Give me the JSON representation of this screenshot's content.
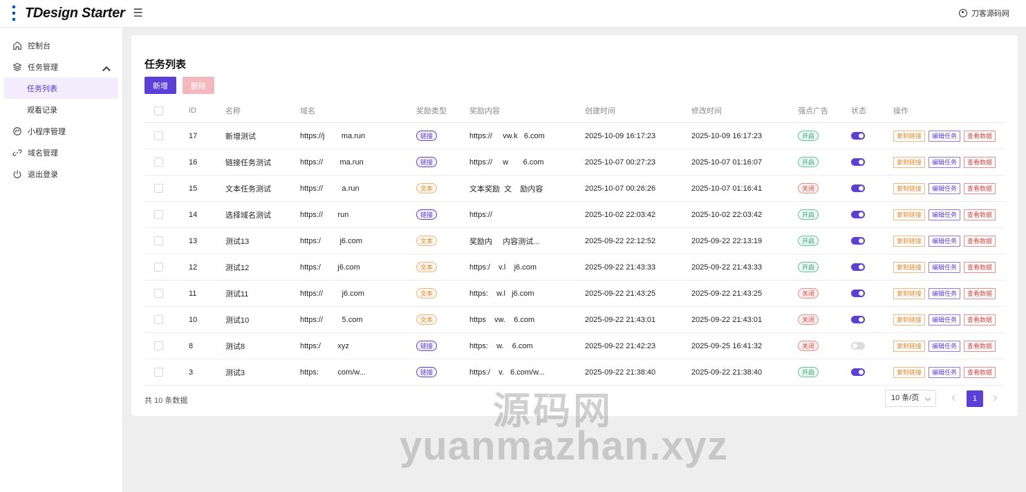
{
  "header": {
    "logo_text": "TDesign Starter",
    "menu_icon": "menu-icon",
    "user_name": "刀客源码网",
    "user_icon": "user-circle-icon"
  },
  "sidebar": {
    "items": [
      {
        "label": "控制台",
        "icon": "home-icon"
      },
      {
        "label": "任务管理",
        "icon": "layers-icon",
        "expanded": true
      },
      {
        "label": "任务列表",
        "sub": true,
        "active": true
      },
      {
        "label": "观看记录",
        "sub": true
      },
      {
        "label": "小程序管理",
        "icon": "miniapp-icon"
      },
      {
        "label": "域名管理",
        "icon": "link-icon"
      },
      {
        "label": "退出登录",
        "icon": "power-icon"
      }
    ]
  },
  "page": {
    "title": "任务列表",
    "add_label": "新增",
    "delete_label": "删除"
  },
  "table": {
    "columns": [
      "ID",
      "名称",
      "域名",
      "奖励类型",
      "奖励内容",
      "创建时间",
      "修改时间",
      "强点广告",
      "状态",
      "操作"
    ],
    "action_labels": {
      "copy": "复制链接",
      "edit": "编辑任务",
      "view": "查看数据"
    },
    "rows": [
      {
        "id": "17",
        "name": "新增测试",
        "domain": "https://j        ma.run",
        "type": "链接",
        "reward": "https://     vw.k   6.com",
        "created": "2025-10-09 16:17:23",
        "updated": "2025-10-09 16:17:23",
        "ad": "开启",
        "enabled": true
      },
      {
        "id": "16",
        "name": "链接任务测试",
        "domain": "https://        ma.run",
        "type": "链接",
        "reward": "https://     w       6.com",
        "created": "2025-10-07 00:27:23",
        "updated": "2025-10-07 01:16:07",
        "ad": "开启",
        "enabled": true
      },
      {
        "id": "15",
        "name": "文本任务测试",
        "domain": "https://         a.run",
        "type": "文本",
        "reward": "文本奖励  文    励内容",
        "created": "2025-10-07 00:26:26",
        "updated": "2025-10-07 01:16:41",
        "ad": "关闭",
        "enabled": true
      },
      {
        "id": "14",
        "name": "选择域名测试",
        "domain": "https://       run",
        "type": "链接",
        "reward": "https://",
        "created": "2025-10-02 22:03:42",
        "updated": "2025-10-02 22:03:42",
        "ad": "开启",
        "enabled": true
      },
      {
        "id": "13",
        "name": "测试13",
        "domain": "https:/         j6.com",
        "type": "文本",
        "reward": "奖励内     内容测试...",
        "created": "2025-09-22 22:12:52",
        "updated": "2025-09-22 22:13:19",
        "ad": "开启",
        "enabled": true
      },
      {
        "id": "12",
        "name": "测试12",
        "domain": "https:/        j6.com",
        "type": "文本",
        "reward": "https:/    v.l    j6.com",
        "created": "2025-09-22 21:43:33",
        "updated": "2025-09-22 21:43:33",
        "ad": "开启",
        "enabled": true
      },
      {
        "id": "11",
        "name": "测试11",
        "domain": "https://         j6.com",
        "type": "文本",
        "reward": "https:    w.l   j6.com",
        "created": "2025-09-22 21:43:25",
        "updated": "2025-09-22 21:43:25",
        "ad": "关闭",
        "enabled": true
      },
      {
        "id": "10",
        "name": "测试10",
        "domain": "https://         5.com",
        "type": "文本",
        "reward": "https    vw.    6.com",
        "created": "2025-09-22 21:43:01",
        "updated": "2025-09-22 21:43:01",
        "ad": "关闭",
        "enabled": true
      },
      {
        "id": "8",
        "name": "测试8",
        "domain": "https:/        xyz",
        "type": "链接",
        "reward": "https:    w.    6.com",
        "created": "2025-09-22 21:42:23",
        "updated": "2025-09-25 16:41:32",
        "ad": "关闭",
        "enabled": false
      },
      {
        "id": "3",
        "name": "测试3",
        "domain": "https:         com/w...",
        "type": "链接",
        "reward": "https:/    v.   6.com/w...",
        "created": "2025-09-22 21:38:40",
        "updated": "2025-09-22 21:38:40",
        "ad": "开启",
        "enabled": true
      }
    ]
  },
  "pagination": {
    "total_text": "共 10 条数据",
    "page_size": "10 条/页",
    "current_page": "1"
  },
  "watermark": {
    "line1": "源码网",
    "line2": "yuanmazhan.xyz"
  },
  "colors": {
    "primary": "#5b3fd9",
    "danger_light": "#f2b8bd",
    "success": "#2ba471",
    "warning": "#e08a2c",
    "error": "#d54941"
  }
}
